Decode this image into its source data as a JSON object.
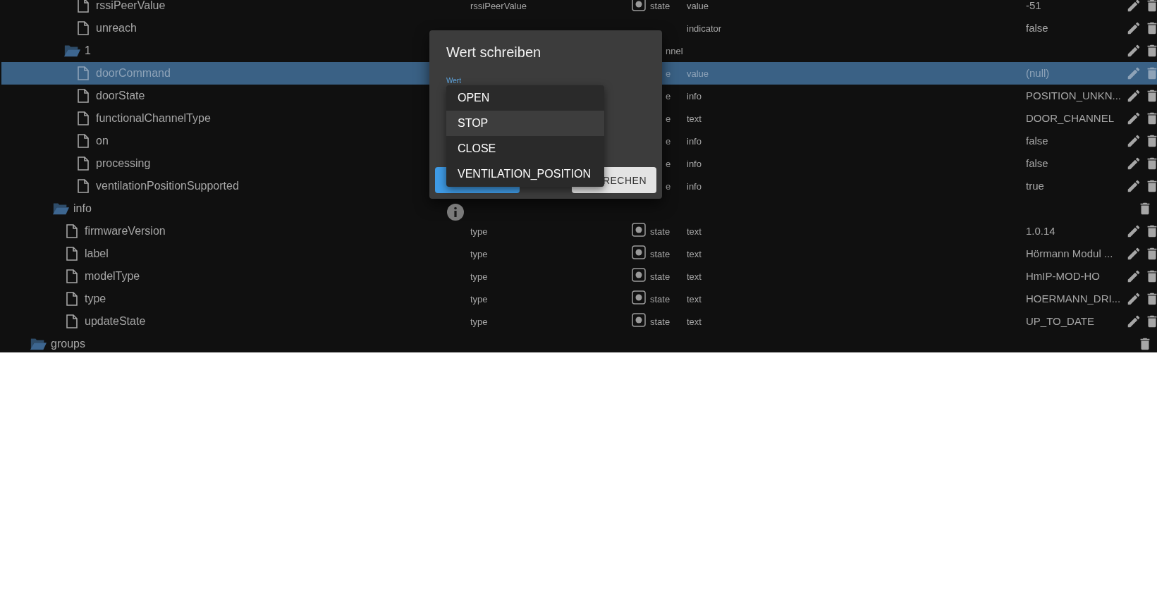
{
  "tree": [
    {
      "children": [
        {
          "children": [
            {
              "children": [
                {
                  "children": [
                    {
                      "kind": "file",
                      "name": "rssiPeerValue",
                      "column_2": "rssiPeerValue",
                      "type": "state",
                      "role": "value",
                      "value": "-51",
                      "editable": true,
                      "selected": false
                    },
                    {
                      "kind": "file",
                      "name": "unreach",
                      "role": "indicator",
                      "value": "false",
                      "editable": true,
                      "selected": false
                    }
                  ]
                },
                {
                  "kind": "folder",
                  "name": "1",
                  "type_fragment": "nnel",
                  "editable": true,
                  "selected": false,
                  "children": [
                    {
                      "kind": "file",
                      "name": "doorCommand",
                      "type_fragment": "e",
                      "role": "value",
                      "value": "(null)",
                      "editable": true,
                      "selected": true
                    },
                    {
                      "kind": "file",
                      "name": "doorState",
                      "type_fragment": "e",
                      "role": "info",
                      "value": "POSITION_UNKN...",
                      "editable": true,
                      "selected": false
                    },
                    {
                      "kind": "file",
                      "name": "functionalChannelType",
                      "type_fragment": "e",
                      "role": "text",
                      "value": "DOOR_CHANNEL",
                      "editable": true,
                      "selected": false
                    },
                    {
                      "kind": "file",
                      "name": "on",
                      "type_fragment": "e",
                      "role": "info",
                      "value": "false",
                      "editable": true,
                      "selected": false
                    },
                    {
                      "kind": "file",
                      "name": "processing",
                      "type_fragment": "e",
                      "role": "info",
                      "value": "false",
                      "editable": true,
                      "selected": false
                    },
                    {
                      "kind": "file",
                      "name": "ventilationPositionSupported",
                      "type_fragment": "e",
                      "role": "info",
                      "value": "true",
                      "editable": true,
                      "selected": false
                    }
                  ]
                }
              ]
            },
            {
              "kind": "folder",
              "name": "info",
              "editable": false,
              "selected": false,
              "children": [
                {
                  "kind": "file",
                  "name": "firmwareVersion",
                  "column_2": "type",
                  "type": "state",
                  "role": "text",
                  "value": "1.0.14",
                  "editable": true,
                  "selected": false
                },
                {
                  "kind": "file",
                  "name": "label",
                  "column_2": "type",
                  "type": "state",
                  "role": "text",
                  "value": "Hörmann Modul ...",
                  "editable": true,
                  "selected": false
                },
                {
                  "kind": "file",
                  "name": "modelType",
                  "column_2": "type",
                  "type": "state",
                  "role": "text",
                  "value": "HmIP-MOD-HO",
                  "editable": true,
                  "selected": false
                },
                {
                  "kind": "file",
                  "name": "type",
                  "column_2": "type",
                  "type": "state",
                  "role": "text",
                  "value": "HOERMANN_DRI...",
                  "editable": true,
                  "selected": false
                },
                {
                  "kind": "file",
                  "name": "updateState",
                  "column_2": "type",
                  "type": "state",
                  "role": "text",
                  "value": "UP_TO_DATE",
                  "editable": true,
                  "selected": false
                }
              ]
            }
          ]
        }
      ]
    },
    {
      "kind": "folder",
      "name": "groups",
      "editable": false,
      "selected": false
    }
  ],
  "dialog": {
    "title": "Wert schreiben",
    "field_label": "Wert",
    "options": [
      {
        "label": "OPEN",
        "selected": false
      },
      {
        "label": "STOP",
        "selected": true
      },
      {
        "label": "CLOSE",
        "selected": false
      },
      {
        "label": "VENTILATION_POSITION",
        "selected": false
      }
    ],
    "cancel_button": "RECHEN"
  }
}
